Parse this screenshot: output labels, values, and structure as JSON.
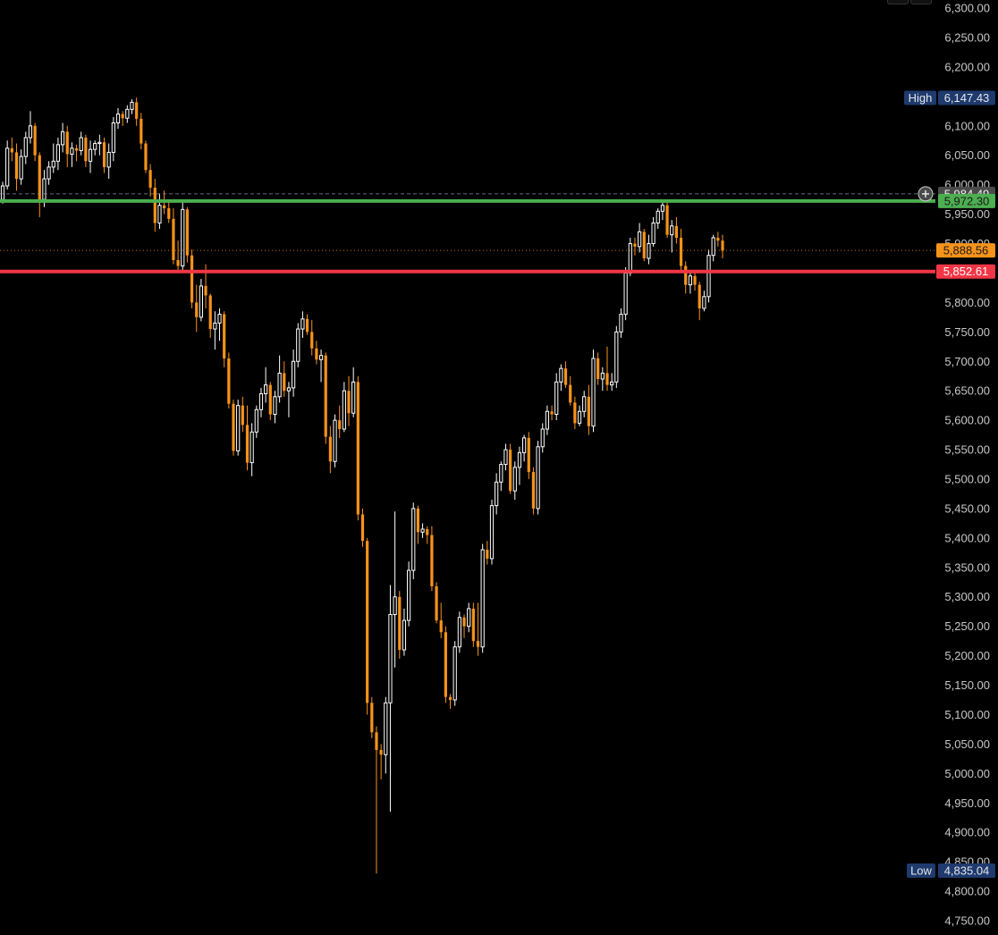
{
  "chart_data": {
    "type": "candlestick",
    "price_axis": {
      "ticks": [
        "6,300.00",
        "6,250.00",
        "6,200.00",
        "6,100.00",
        "6,050.00",
        "6,000.00",
        "5,950.00",
        "5,900.00",
        "5,800.00",
        "5,750.00",
        "5,700.00",
        "5,650.00",
        "5,600.00",
        "5,550.00",
        "5,500.00",
        "5,450.00",
        "5,400.00",
        "5,350.00",
        "5,300.00",
        "5,250.00",
        "5,200.00",
        "5,150.00",
        "5,100.00",
        "5,050.00",
        "5,000.00",
        "4,950.00",
        "4,900.00",
        "4,850.00",
        "4,800.00",
        "4,750.00"
      ],
      "tick_values": [
        6300,
        6250,
        6200,
        6100,
        6050,
        6000,
        5950,
        5900,
        5800,
        5750,
        5700,
        5650,
        5600,
        5550,
        5500,
        5450,
        5400,
        5350,
        5300,
        5250,
        5200,
        5150,
        5100,
        5050,
        5000,
        4950,
        4900,
        4850,
        4800,
        4750
      ],
      "range": [
        4735,
        6310
      ]
    },
    "markers": {
      "high": {
        "label": "High",
        "value": "6,147.43",
        "price": 6147.43
      },
      "low": {
        "label": "Low",
        "value": "4,835.04",
        "price": 4835.04
      },
      "crosshair": {
        "value": "5,984.49",
        "price": 5984.49
      },
      "last_price": {
        "value": "5,888.56",
        "price": 5888.56
      },
      "red_level": {
        "value": "5,852.61",
        "price": 5852.61
      },
      "green_level": {
        "value": "5,972.30",
        "price": 5972.3
      }
    },
    "colors": {
      "background": "#000000",
      "up_candle": "#ffffff",
      "down_candle": "#f7931a",
      "green_line": "#4caf50",
      "red_line": "#f23645",
      "high_low_badge": "#1e3a6e",
      "crosshair_badge": "#4a4a4a",
      "last_price_badge": "#f7931a"
    },
    "candles": [
      [
        5975,
        6005,
        5968,
        5998
      ],
      [
        5998,
        6075,
        5992,
        6062
      ],
      [
        6062,
        6080,
        6040,
        6055
      ],
      [
        6055,
        6070,
        5990,
        6010
      ],
      [
        6010,
        6060,
        6000,
        6048
      ],
      [
        6048,
        6090,
        6035,
        6080
      ],
      [
        6080,
        6125,
        6070,
        6100
      ],
      [
        6100,
        6105,
        6040,
        6050
      ],
      [
        6050,
        6055,
        5945,
        5975
      ],
      [
        5975,
        6025,
        5962,
        6010
      ],
      [
        6010,
        6040,
        6000,
        6030
      ],
      [
        6030,
        6070,
        6020,
        6040
      ],
      [
        6040,
        6080,
        6025,
        6068
      ],
      [
        6068,
        6105,
        6055,
        6090
      ],
      [
        6090,
        6100,
        6030,
        6052
      ],
      [
        6052,
        6072,
        6030,
        6062
      ],
      [
        6062,
        6068,
        6040,
        6058
      ],
      [
        6058,
        6090,
        6050,
        6080
      ],
      [
        6080,
        6085,
        6030,
        6040
      ],
      [
        6040,
        6075,
        6020,
        6060
      ],
      [
        6060,
        6075,
        6050,
        6070
      ],
      [
        6070,
        6085,
        6050,
        6072
      ],
      [
        6072,
        6080,
        6020,
        6030
      ],
      [
        6030,
        6070,
        6010,
        6055
      ],
      [
        6055,
        6115,
        6040,
        6105
      ],
      [
        6105,
        6130,
        6095,
        6120
      ],
      [
        6120,
        6125,
        6100,
        6113
      ],
      [
        6113,
        6135,
        6105,
        6128
      ],
      [
        6128,
        6145,
        6120,
        6140
      ],
      [
        6140,
        6148,
        6100,
        6112
      ],
      [
        6112,
        6122,
        6060,
        6070
      ],
      [
        6070,
        6075,
        6020,
        6025
      ],
      [
        6025,
        6035,
        5980,
        5995
      ],
      [
        5995,
        6010,
        5920,
        5935
      ],
      [
        5935,
        5985,
        5925,
        5965
      ],
      [
        5965,
        5990,
        5950,
        5960
      ],
      [
        5960,
        5975,
        5935,
        5942
      ],
      [
        5942,
        5960,
        5865,
        5872
      ],
      [
        5872,
        5905,
        5850,
        5862
      ],
      [
        5862,
        5975,
        5855,
        5958
      ],
      [
        5958,
        5962,
        5868,
        5880
      ],
      [
        5880,
        5890,
        5790,
        5800
      ],
      [
        5800,
        5830,
        5750,
        5775
      ],
      [
        5775,
        5840,
        5768,
        5828
      ],
      [
        5828,
        5865,
        5790,
        5812
      ],
      [
        5812,
        5815,
        5740,
        5755
      ],
      [
        5755,
        5785,
        5720,
        5765
      ],
      [
        5765,
        5790,
        5735,
        5780
      ],
      [
        5780,
        5785,
        5690,
        5705
      ],
      [
        5705,
        5715,
        5620,
        5628
      ],
      [
        5628,
        5635,
        5540,
        5548
      ],
      [
        5548,
        5635,
        5540,
        5625
      ],
      [
        5625,
        5640,
        5580,
        5592
      ],
      [
        5592,
        5625,
        5515,
        5528
      ],
      [
        5528,
        5595,
        5505,
        5580
      ],
      [
        5580,
        5625,
        5570,
        5618
      ],
      [
        5618,
        5655,
        5605,
        5645
      ],
      [
        5645,
        5690,
        5630,
        5660
      ],
      [
        5660,
        5665,
        5600,
        5610
      ],
      [
        5610,
        5650,
        5595,
        5640
      ],
      [
        5640,
        5710,
        5630,
        5680
      ],
      [
        5680,
        5700,
        5640,
        5650
      ],
      [
        5650,
        5665,
        5605,
        5655
      ],
      [
        5655,
        5720,
        5640,
        5700
      ],
      [
        5700,
        5765,
        5690,
        5755
      ],
      [
        5755,
        5785,
        5740,
        5772
      ],
      [
        5772,
        5780,
        5745,
        5750
      ],
      [
        5750,
        5770,
        5710,
        5722
      ],
      [
        5722,
        5735,
        5695,
        5703
      ],
      [
        5703,
        5720,
        5665,
        5710
      ],
      [
        5710,
        5715,
        5560,
        5572
      ],
      [
        5572,
        5590,
        5510,
        5530
      ],
      [
        5530,
        5610,
        5520,
        5600
      ],
      [
        5600,
        5625,
        5570,
        5585
      ],
      [
        5585,
        5665,
        5580,
        5650
      ],
      [
        5650,
        5675,
        5590,
        5612
      ],
      [
        5612,
        5690,
        5605,
        5665
      ],
      [
        5665,
        5675,
        5430,
        5440
      ],
      [
        5440,
        5450,
        5385,
        5395
      ],
      [
        5395,
        5400,
        5100,
        5120
      ],
      [
        5120,
        5130,
        5060,
        5070
      ],
      [
        5070,
        5080,
        4830,
        5040
      ],
      [
        5040,
        5050,
        4990,
        5032
      ],
      [
        5032,
        5130,
        5000,
        5120
      ],
      [
        5120,
        5320,
        4935,
        5270
      ],
      [
        5270,
        5445,
        5180,
        5300
      ],
      [
        5300,
        5310,
        5195,
        5210
      ],
      [
        5210,
        5280,
        5200,
        5260
      ],
      [
        5260,
        5360,
        5250,
        5345
      ],
      [
        5345,
        5460,
        5330,
        5450
      ],
      [
        5450,
        5455,
        5390,
        5410
      ],
      [
        5410,
        5425,
        5400,
        5415
      ],
      [
        5415,
        5420,
        5390,
        5405
      ],
      [
        5405,
        5420,
        5310,
        5318
      ],
      [
        5318,
        5325,
        5255,
        5260
      ],
      [
        5260,
        5290,
        5230,
        5240
      ],
      [
        5240,
        5250,
        5120,
        5130
      ],
      [
        5130,
        5135,
        5110,
        5125
      ],
      [
        5125,
        5225,
        5115,
        5215
      ],
      [
        5215,
        5275,
        5205,
        5265
      ],
      [
        5265,
        5270,
        5230,
        5250
      ],
      [
        5250,
        5290,
        5240,
        5280
      ],
      [
        5280,
        5290,
        5215,
        5225
      ],
      [
        5225,
        5290,
        5200,
        5215
      ],
      [
        5215,
        5390,
        5205,
        5380
      ],
      [
        5380,
        5395,
        5355,
        5365
      ],
      [
        5365,
        5465,
        5355,
        5455
      ],
      [
        5455,
        5510,
        5440,
        5495
      ],
      [
        5495,
        5530,
        5480,
        5525
      ],
      [
        5525,
        5560,
        5515,
        5550
      ],
      [
        5550,
        5560,
        5475,
        5480
      ],
      [
        5480,
        5530,
        5465,
        5520
      ],
      [
        5520,
        5555,
        5490,
        5545
      ],
      [
        5545,
        5575,
        5530,
        5570
      ],
      [
        5570,
        5580,
        5500,
        5512
      ],
      [
        5512,
        5520,
        5440,
        5450
      ],
      [
        5450,
        5565,
        5440,
        5555
      ],
      [
        5555,
        5595,
        5545,
        5585
      ],
      [
        5585,
        5625,
        5575,
        5615
      ],
      [
        5615,
        5625,
        5600,
        5610
      ],
      [
        5610,
        5680,
        5600,
        5665
      ],
      [
        5665,
        5695,
        5650,
        5688
      ],
      [
        5688,
        5700,
        5655,
        5660
      ],
      [
        5660,
        5675,
        5625,
        5630
      ],
      [
        5630,
        5640,
        5585,
        5595
      ],
      [
        5595,
        5625,
        5590,
        5615
      ],
      [
        5615,
        5650,
        5605,
        5640
      ],
      [
        5640,
        5660,
        5575,
        5590
      ],
      [
        5590,
        5720,
        5580,
        5705
      ],
      [
        5705,
        5715,
        5660,
        5670
      ],
      [
        5670,
        5690,
        5650,
        5680
      ],
      [
        5680,
        5725,
        5650,
        5660
      ],
      [
        5660,
        5680,
        5650,
        5665
      ],
      [
        5665,
        5760,
        5655,
        5750
      ],
      [
        5750,
        5790,
        5740,
        5780
      ],
      [
        5780,
        5860,
        5770,
        5850
      ],
      [
        5850,
        5910,
        5845,
        5900
      ],
      [
        5900,
        5910,
        5880,
        5895
      ],
      [
        5895,
        5935,
        5885,
        5920
      ],
      [
        5920,
        5925,
        5870,
        5875
      ],
      [
        5875,
        5915,
        5865,
        5900
      ],
      [
        5900,
        5945,
        5895,
        5935
      ],
      [
        5935,
        5960,
        5925,
        5955
      ],
      [
        5955,
        5975,
        5940,
        5965
      ],
      [
        5965,
        5975,
        5910,
        5915
      ],
      [
        5915,
        5940,
        5885,
        5930
      ],
      [
        5930,
        5945,
        5900,
        5910
      ],
      [
        5910,
        5925,
        5855,
        5862
      ],
      [
        5862,
        5870,
        5815,
        5830
      ],
      [
        5830,
        5855,
        5815,
        5845
      ],
      [
        5845,
        5855,
        5820,
        5830
      ],
      [
        5830,
        5835,
        5770,
        5790
      ],
      [
        5790,
        5820,
        5785,
        5810
      ],
      [
        5810,
        5890,
        5800,
        5880
      ],
      [
        5880,
        5915,
        5870,
        5910
      ],
      [
        5910,
        5920,
        5895,
        5905
      ],
      [
        5905,
        5915,
        5875,
        5888
      ]
    ]
  }
}
